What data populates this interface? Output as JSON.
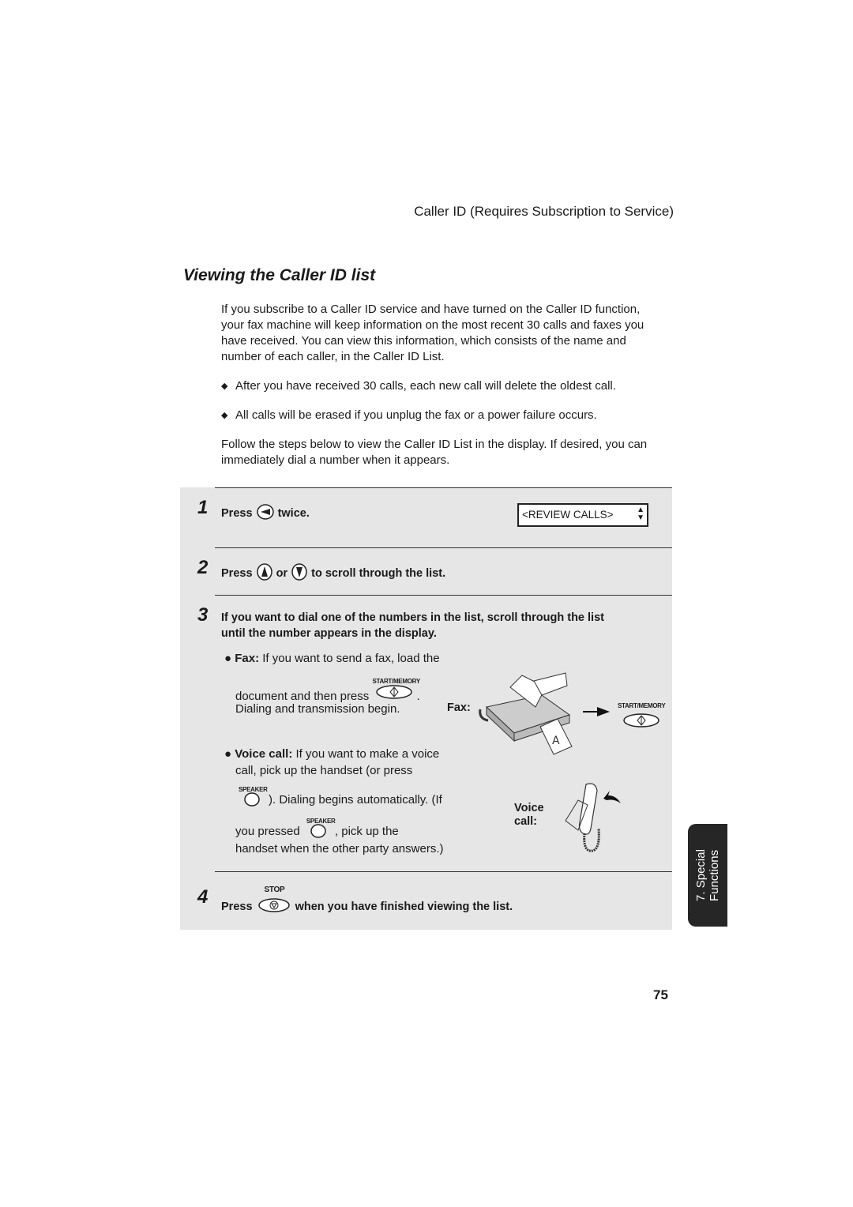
{
  "header": {
    "section_title": "Caller ID (Requires Subscription to Service)"
  },
  "title": "Viewing the Caller ID list",
  "intro": "If you subscribe to a Caller ID service and have turned on the Caller ID function, your fax machine will keep information on the most recent 30 calls and faxes you have received. You can view this information, which consists of the name and number of each caller, in the Caller ID List.",
  "bullets": [
    "After you have received 30 calls, each new call will delete the oldest call.",
    "All calls will be erased if you unplug the fax or a power failure occurs."
  ],
  "follow_text": "Follow the steps below to view the Caller ID List in the display. If desired, you can immediately dial a number when it appears.",
  "steps": [
    {
      "num": "1",
      "press": "Press",
      "after": "twice.",
      "key_icon": "left-arrow-key-icon",
      "display": "<REVIEW CALLS>"
    },
    {
      "num": "2",
      "press": "Press",
      "or": "or",
      "after": "to  scroll through the list.",
      "key_icons": [
        "up-arrow-key-icon",
        "down-arrow-key-icon"
      ]
    },
    {
      "num": "3",
      "line1": "If you want to dial one of the numbers in the list, scroll through the list",
      "line2": "until the number appears in the display.",
      "fax": {
        "label": "Fax:",
        "line1": " If you want to send a fax, load the",
        "line2": "document and then press",
        "line2_end": ".",
        "line3": "Dialing and transmission begin.",
        "key_label": "START/MEMORY",
        "figure_label": "Fax:"
      },
      "voice": {
        "label": "Voice call:",
        "line1": " If you want to make a voice",
        "line2": "call, pick up the handset (or press",
        "line3": "). Dialing begins automatically. (If",
        "line4a": "you pressed",
        "line4b": ", pick up the",
        "line5": "handset when the other party answers.)",
        "key_label": "SPEAKER",
        "figure_label_1": "Voice",
        "figure_label_2": "call:"
      }
    },
    {
      "num": "4",
      "press": "Press",
      "key_label": "STOP",
      "after": "when you have finished viewing the list."
    }
  ],
  "side_tab": {
    "line1": "7. Special",
    "line2": "Functions"
  },
  "page_number": "75"
}
